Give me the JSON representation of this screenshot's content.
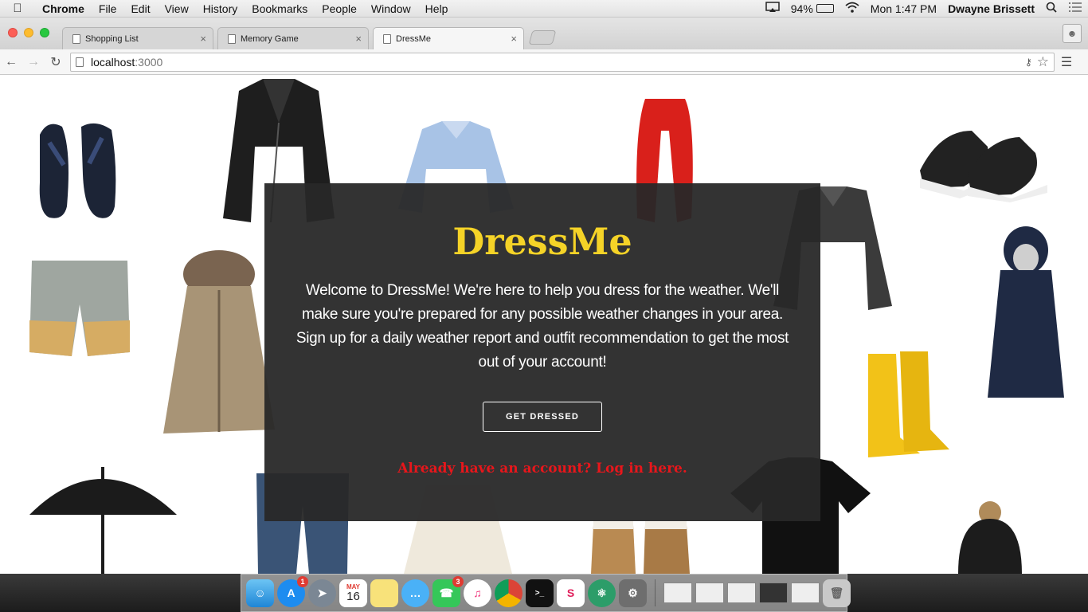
{
  "menubar": {
    "app_name": "Chrome",
    "menus": [
      "File",
      "Edit",
      "View",
      "History",
      "Bookmarks",
      "People",
      "Window",
      "Help"
    ],
    "battery": "94%",
    "battery_level": 0.94,
    "clock": "Mon 1:47 PM",
    "user": "Dwayne Brissett"
  },
  "browser": {
    "tabs": [
      {
        "title": "Shopping List",
        "active": false
      },
      {
        "title": "Memory Game",
        "active": false
      },
      {
        "title": "DressMe",
        "active": true
      }
    ],
    "address": {
      "host": "localhost",
      "port": ":3000"
    }
  },
  "page": {
    "brand": "DressMe",
    "welcome": "Welcome to DressMe! We're here to help you dress for the weather. We'll make sure you're prepared for any possible weather changes in your area. Sign up for a daily weather report and outfit recommendation to get the most out of your account!",
    "cta_label": "GET DRESSED",
    "login_link": "Already have an account? Log in here.",
    "colors": {
      "brand": "#f5d327",
      "login_link": "#e8161b",
      "overlay": "#282828"
    }
  },
  "dock": {
    "app_store_badge": "1",
    "messages_badge": "3",
    "calendar_month": "MAY",
    "calendar_day": "16"
  }
}
